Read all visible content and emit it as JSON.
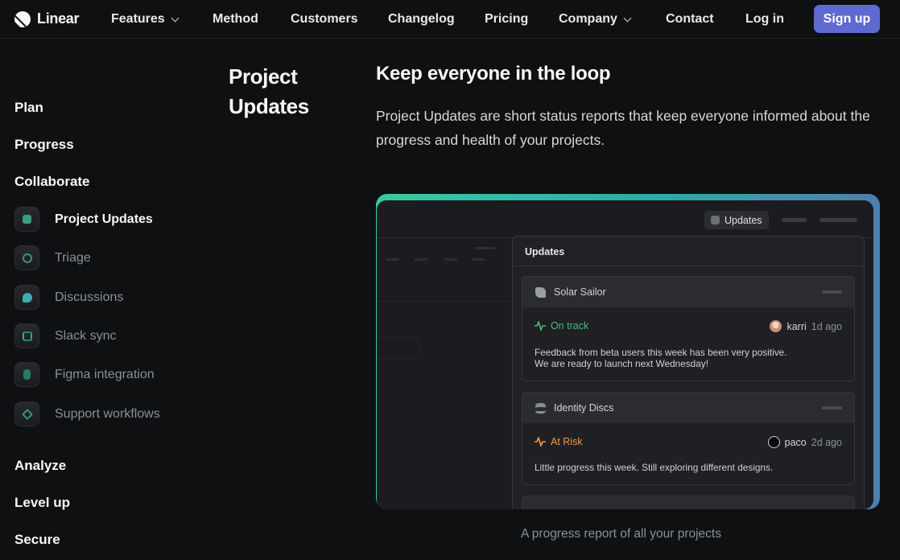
{
  "nav": {
    "brand": "Linear",
    "items": [
      {
        "label": "Features",
        "dropdown": true
      },
      {
        "label": "Method",
        "dropdown": false
      },
      {
        "label": "Customers",
        "dropdown": false
      },
      {
        "label": "Changelog",
        "dropdown": false
      },
      {
        "label": "Pricing",
        "dropdown": false
      },
      {
        "label": "Company",
        "dropdown": true
      },
      {
        "label": "Contact",
        "dropdown": false
      }
    ],
    "login": "Log in",
    "signup": "Sign up"
  },
  "sidebar": {
    "groups": [
      "Plan",
      "Progress",
      "Collaborate"
    ],
    "items": [
      {
        "label": "Project Updates",
        "icon": "project-updates-icon",
        "active": true,
        "color": "#3ec7a3"
      },
      {
        "label": "Triage",
        "icon": "triage-icon",
        "active": false,
        "color": "#3ec7a3"
      },
      {
        "label": "Discussions",
        "icon": "discussions-icon",
        "active": false,
        "color": "#3ec7c7"
      },
      {
        "label": "Slack sync",
        "icon": "slack-icon",
        "active": false,
        "color": "#3ec7a3"
      },
      {
        "label": "Figma integration",
        "icon": "figma-icon",
        "active": false,
        "color": "#3ec7a3"
      },
      {
        "label": "Support workflows",
        "icon": "support-icon",
        "active": false,
        "color": "#3ec7a3"
      }
    ],
    "bottom_groups": [
      "Analyze",
      "Level up",
      "Secure"
    ]
  },
  "content": {
    "section_title_line1": "Project",
    "section_title_line2": "Updates",
    "headline": "Keep everyone in the loop",
    "paragraph": "Project Updates are short status reports that keep everyone informed about the progress and health of your projects.",
    "caption": "A progress report of all your projects"
  },
  "mockup": {
    "top_button": "Updates",
    "panel_title": "Updates",
    "updates": [
      {
        "project": "Solar Sailor",
        "status": "On track",
        "status_color": "#4cb782",
        "author": "karri",
        "ago": "1d ago",
        "body_line1": "Feedback from beta users this week has been very positive.",
        "body_line2": "We are ready to launch next Wednesday!"
      },
      {
        "project": "Identity Discs",
        "status": "At Risk",
        "status_color": "#f2994a",
        "author": "paco",
        "ago": "2d ago",
        "body_line1": "Little progress this week. Still exploring different designs."
      }
    ]
  }
}
